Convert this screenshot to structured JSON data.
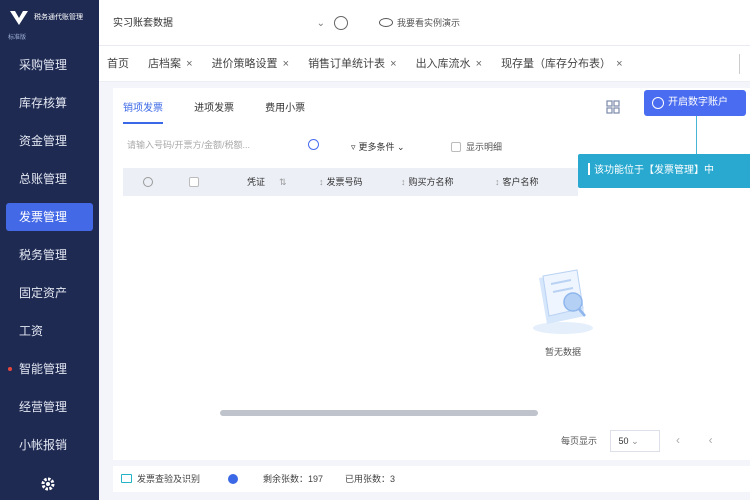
{
  "brand": {
    "name": "税务通代账管理",
    "sub": "标准版"
  },
  "sidebar": {
    "items": [
      {
        "label": "采购管理"
      },
      {
        "label": "库存核算"
      },
      {
        "label": "资金管理"
      },
      {
        "label": "总账管理"
      },
      {
        "label": "发票管理"
      },
      {
        "label": "税务管理"
      },
      {
        "label": "固定资产"
      },
      {
        "label": "工资"
      },
      {
        "label": "智能管理"
      },
      {
        "label": "经营管理"
      },
      {
        "label": "小帐报销"
      }
    ]
  },
  "topbar": {
    "company": "实习账套数据",
    "demo": "我要看实例演示"
  },
  "tabs": [
    {
      "label": "首页"
    },
    {
      "label": "店档案"
    },
    {
      "label": "进价策略设置"
    },
    {
      "label": "销售订单统计表"
    },
    {
      "label": "出入库流水"
    },
    {
      "label": "现存量（库存分布表）"
    }
  ],
  "subtabs": [
    {
      "label": "销项发票"
    },
    {
      "label": "进项发票"
    },
    {
      "label": "费用小票"
    }
  ],
  "open_button": "开启数字账户",
  "guide_tip": "该功能位于【发票管理】中",
  "search": {
    "placeholder": "请输入号码/开票方/金额/税额..."
  },
  "more_filters": "更多条件",
  "show_detail": "显示明细",
  "table": {
    "headers": [
      "凭证",
      "发票号码",
      "购买方名称",
      "客户名称"
    ]
  },
  "empty_text": "暂无数据",
  "pager": {
    "label": "每页显示",
    "size": "50"
  },
  "footer": {
    "label": "发票查验及识别",
    "remaining": "剩余张数：197",
    "used": "已用张数：3"
  },
  "colors": {
    "sidebar": "#1e2a52",
    "accent": "#4a6cf0",
    "guide": "#29a9d0"
  }
}
